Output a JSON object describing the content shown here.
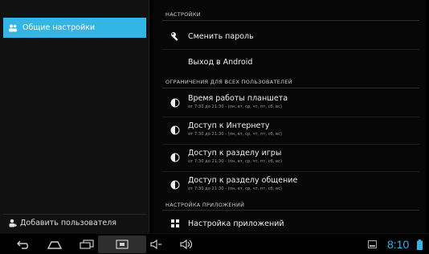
{
  "left_pane": {
    "active_item": "Общие настройки",
    "add_user": "Добавить пользователя"
  },
  "sections": [
    {
      "header": "НАСТРОЙКИ",
      "rows": [
        {
          "icon": "wrench-icon",
          "title": "Сменить пароль",
          "sub": ""
        },
        {
          "icon": "",
          "title": "Выход в Android",
          "sub": ""
        }
      ]
    },
    {
      "header": "ОГРАНИЧЕНИЯ ДЛЯ ВСЕХ ПОЛЬЗОВАТЕЛЕЙ",
      "rows": [
        {
          "icon": "clock-icon",
          "title": "Время работы планшета",
          "sub": "от 7:30 до 21:30 - (пн, вт, ср, чт, пт, сб, вс)"
        },
        {
          "icon": "clock-icon",
          "title": "Доступ к Интернету",
          "sub": "от 7:30 до 21:30 - (пн, вт, ср, чт, пт, сб, вс)"
        },
        {
          "icon": "clock-icon",
          "title": "Доступ к разделу игры",
          "sub": "от 7:30 до 21:30 - (пн, вт, ср, чт, пт, сб, вс)"
        },
        {
          "icon": "clock-icon",
          "title": "Доступ к разделу общение",
          "sub": "от 7:30 до 21:30 - (пн, вт, ср, чт, пт, сб, вс)"
        }
      ]
    },
    {
      "header": "НАСТРОЙКА ПРИЛОЖЕНИЙ",
      "rows": [
        {
          "icon": "grid-icon",
          "title": "Настройка приложений",
          "sub": ""
        }
      ]
    }
  ],
  "status_bar": {
    "time": "8:10"
  },
  "colors": {
    "accent": "#33b5e5",
    "background": "#000000"
  }
}
